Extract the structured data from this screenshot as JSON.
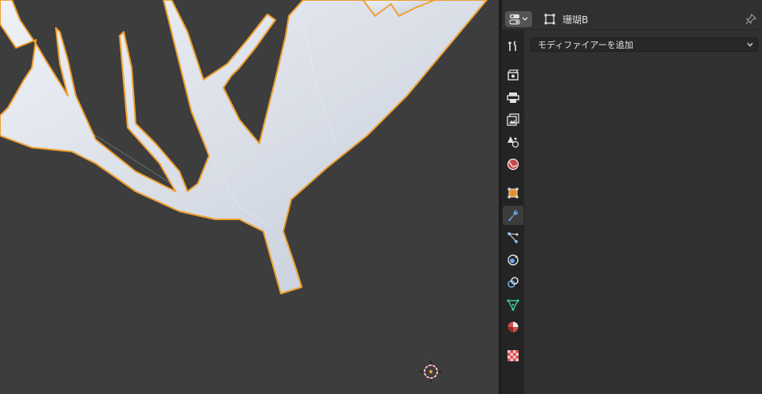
{
  "viewport": {
    "background": "#3d3d3d",
    "selection_outline_color": "#f0a030",
    "mesh_color": "#d8dde6"
  },
  "properties": {
    "object_name": "珊瑚B",
    "add_modifier_label": "モディファイアーを追加",
    "active_tab": "modifier",
    "tabs": [
      {
        "name": "tool-icon"
      },
      {
        "name": "render-icon"
      },
      {
        "name": "output-icon"
      },
      {
        "name": "view-layer-icon"
      },
      {
        "name": "scene-icon"
      },
      {
        "name": "world-icon"
      },
      {
        "name": "object-icon"
      },
      {
        "name": "modifier-wrench-icon"
      },
      {
        "name": "particles-icon"
      },
      {
        "name": "physics-icon"
      },
      {
        "name": "constraints-icon"
      },
      {
        "name": "data-icon"
      },
      {
        "name": "material-icon"
      },
      {
        "name": "texture-icon"
      }
    ]
  }
}
